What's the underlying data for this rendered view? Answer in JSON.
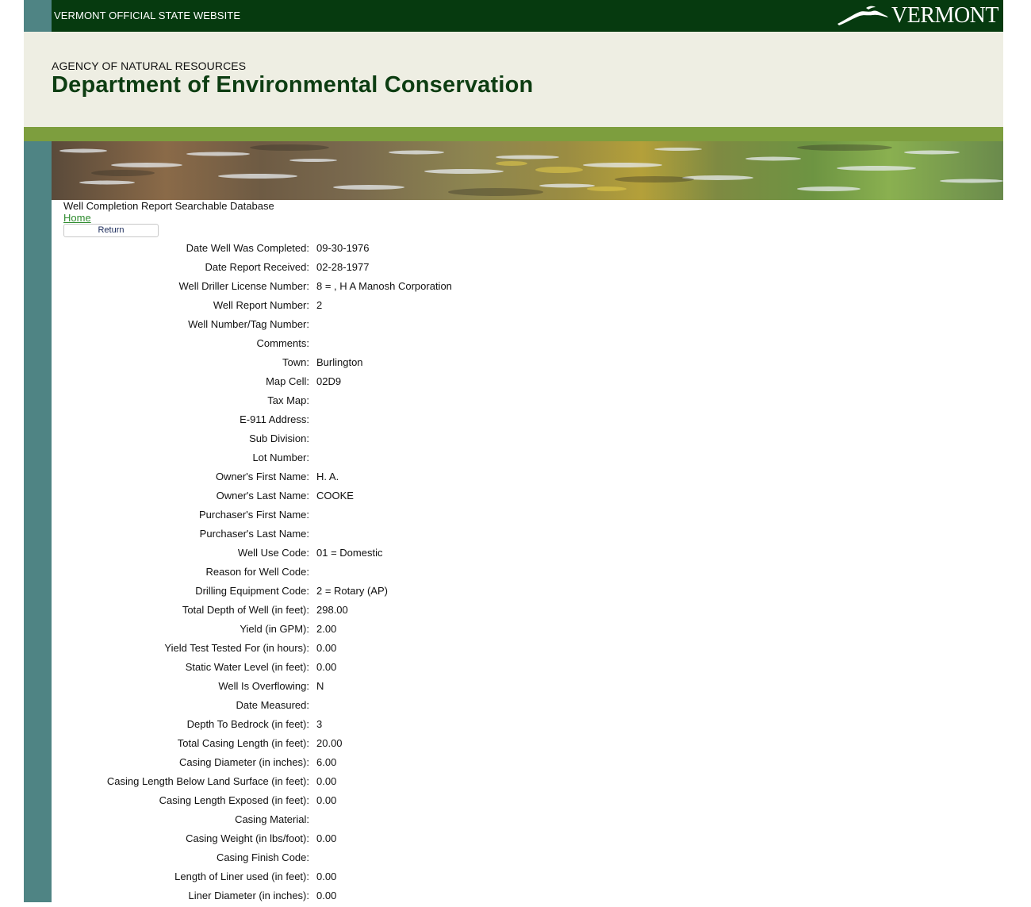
{
  "topbar": {
    "site_label": "VERMONT OFFICIAL STATE WEBSITE",
    "logo_text": "VERMONT",
    "logo_icon": "mountain-bird-icon"
  },
  "header": {
    "agency": "AGENCY OF NATURAL RESOURCES",
    "department": "Department of Environmental Conservation"
  },
  "colors": {
    "topbar": "#063a0f",
    "left_strip": "#4f8484",
    "header_bg": "#eeeee3",
    "green_bar": "#7d9e3e",
    "dept_title": "#0d3d12",
    "link": "#2e8b2e"
  },
  "page": {
    "db_title": "Well Completion Report Searchable Database",
    "home_link": "Home",
    "return_button": "Return"
  },
  "fields": [
    {
      "label": "Date Well Was Completed:",
      "value": "09-30-1976"
    },
    {
      "label": "Date Report Received:",
      "value": "02-28-1977"
    },
    {
      "label": "Well Driller License Number:",
      "value": "8 = , H A Manosh Corporation"
    },
    {
      "label": "Well Report Number:",
      "value": "2"
    },
    {
      "label": "Well Number/Tag Number:",
      "value": ""
    },
    {
      "label": "Comments:",
      "value": ""
    },
    {
      "label": "Town:",
      "value": "Burlington"
    },
    {
      "label": "Map Cell:",
      "value": "02D9"
    },
    {
      "label": "Tax Map:",
      "value": ""
    },
    {
      "label": "E-911 Address:",
      "value": ""
    },
    {
      "label": "Sub Division:",
      "value": ""
    },
    {
      "label": "Lot Number:",
      "value": ""
    },
    {
      "label": "Owner's First Name:",
      "value": "H. A."
    },
    {
      "label": "Owner's Last Name:",
      "value": "COOKE"
    },
    {
      "label": "Purchaser's First Name:",
      "value": ""
    },
    {
      "label": "Purchaser's Last Name:",
      "value": ""
    },
    {
      "label": "Well Use Code:",
      "value": "01 = Domestic"
    },
    {
      "label": "Reason for Well Code:",
      "value": ""
    },
    {
      "label": "Drilling Equipment Code:",
      "value": "2 = Rotary (AP)"
    },
    {
      "label": "Total Depth of Well (in feet):",
      "value": "298.00"
    },
    {
      "label": "Yield (in GPM):",
      "value": "2.00"
    },
    {
      "label": "Yield Test Tested For (in hours):",
      "value": "0.00"
    },
    {
      "label": "Static Water Level (in feet):",
      "value": "0.00"
    },
    {
      "label": "Well Is Overflowing:",
      "value": "N"
    },
    {
      "label": "Date Measured:",
      "value": ""
    },
    {
      "label": "Depth To Bedrock (in feet):",
      "value": "3"
    },
    {
      "label": "Total Casing Length (in feet):",
      "value": "20.00"
    },
    {
      "label": "Casing Diameter (in inches):",
      "value": "6.00"
    },
    {
      "label": "Casing Length Below Land Surface (in feet):",
      "value": "0.00"
    },
    {
      "label": "Casing Length Exposed (in feet):",
      "value": "0.00"
    },
    {
      "label": "Casing Material:",
      "value": ""
    },
    {
      "label": "Casing Weight (in lbs/foot):",
      "value": "0.00"
    },
    {
      "label": "Casing Finish Code:",
      "value": ""
    },
    {
      "label": "Length of Liner used (in feet):",
      "value": "0.00"
    },
    {
      "label": "Liner Diameter (in inches):",
      "value": "0.00"
    }
  ]
}
